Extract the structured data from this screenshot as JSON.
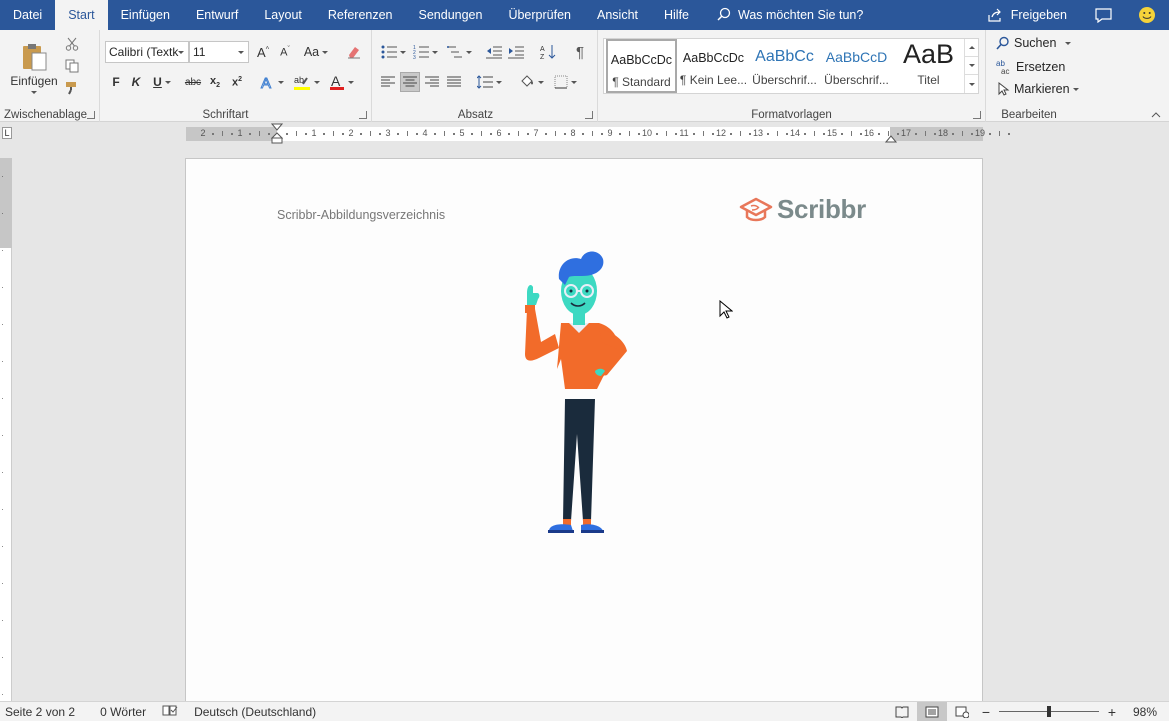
{
  "tabs": [
    "Datei",
    "Start",
    "Einfügen",
    "Entwurf",
    "Layout",
    "Referenzen",
    "Sendungen",
    "Überprüfen",
    "Ansicht",
    "Hilfe"
  ],
  "active_tab": "Start",
  "tell_me": "Was möchten Sie tun?",
  "share": "Freigeben",
  "clipboard": {
    "paste": "Einfügen",
    "label": "Zwischenablage"
  },
  "font": {
    "name": "Calibri (Textk",
    "size": "11",
    "label": "Schriftart",
    "change_case": "Aa"
  },
  "paragraph": {
    "label": "Absatz"
  },
  "styles": {
    "label": "Formatvorlagen",
    "items": [
      {
        "preview": "AaBbCcDc",
        "name": "¶ Standard"
      },
      {
        "preview": "AaBbCcDc",
        "name": "¶ Kein Lee..."
      },
      {
        "preview": "AaBbCc",
        "name": "Überschrif..."
      },
      {
        "preview": "AaBbCcD",
        "name": "Überschrif..."
      },
      {
        "preview": "AaB",
        "name": "Titel"
      }
    ]
  },
  "editing": {
    "find": "Suchen",
    "replace": "Ersetzen",
    "select": "Markieren",
    "label": "Bearbeiten"
  },
  "ruler": {
    "h_numbers": [
      "2",
      "1",
      "",
      "1",
      "2",
      "3",
      "4",
      "5",
      "6",
      "7",
      "8",
      "9",
      "10",
      "11",
      "12",
      "13",
      "14",
      "15",
      "16",
      "17",
      "18",
      "19"
    ]
  },
  "document": {
    "header": "Scribbr-Abbildungsverzeichnis",
    "logo": "Scribbr"
  },
  "status": {
    "page": "Seite 2 von 2",
    "words": "0 Wörter",
    "language": "Deutsch (Deutschland)",
    "zoom": "98%"
  },
  "colors": {
    "accent": "#2b579a",
    "logo": "#e8775a"
  }
}
